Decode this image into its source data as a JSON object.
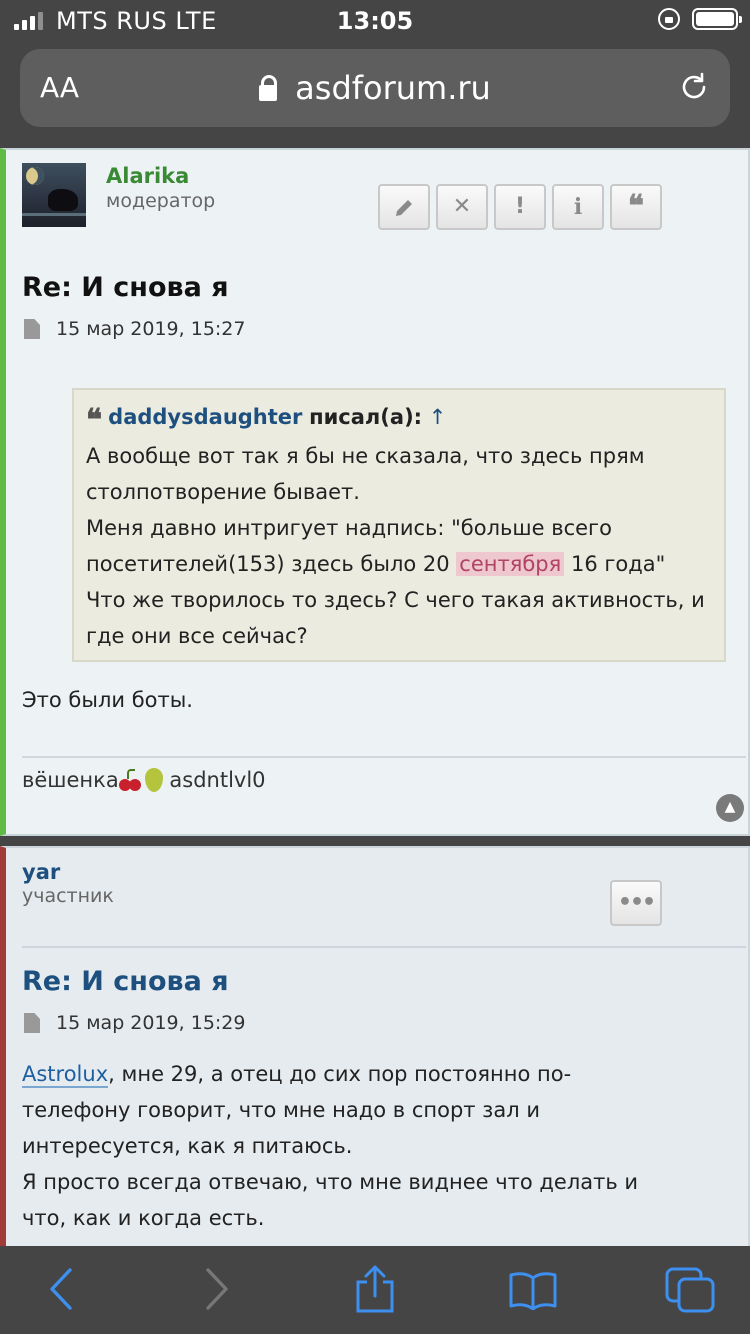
{
  "status_bar": {
    "carrier": "MTS RUS  LTE",
    "time": "13:05"
  },
  "address_bar": {
    "text_size_label": "AA",
    "url": "asdforum.ru"
  },
  "posts": [
    {
      "author": "Alarika",
      "role": "модератор",
      "title": "Re: И снова я",
      "date": "15 мар 2019, 15:27",
      "actions": [
        "edit-icon",
        "delete-icon",
        "report-icon",
        "info-icon",
        "quote-icon"
      ],
      "quote": {
        "author": "daddysdaughter",
        "wrote": "писал(а):",
        "arrow": "↑",
        "line1": "А вообще вот так я бы не сказала, что здесь прям",
        "line2": "столпотворение бывает.",
        "line3": "Меня давно интригует надпись: \"больше всего",
        "line4_a": "посетителей(153) здесь было 20 ",
        "line4_hl": "сентября",
        "line4_b": " 16 года\"",
        "line5": "Что же творилось то здесь? С чего такая активность, и",
        "line6": "где они все сейчас?"
      },
      "reply": "Это были боты.",
      "signature": {
        "part1": "вёшенка",
        "part2": "asdntlvl0"
      }
    },
    {
      "author": "yar",
      "role": "участник",
      "title": "Re: И снова я",
      "date": "15 мар 2019, 15:29",
      "more_label": "•••",
      "mention": "Astrolux",
      "line1_rest": ", мне 29, а отец до сих пор постоянно по-",
      "line2": "телефону говорит, что мне надо в спорт зал и",
      "line3": "интересуется, как я питаюсь.",
      "line4": "Я просто всегда отвечаю, что мне виднее что делать и",
      "line5": "что, как и когда есть."
    }
  ],
  "colors": {
    "moderator": "#3a8a35",
    "link": "#1d4f7f",
    "post1_accent": "#5fbb46",
    "post2_accent": "#a33a3a",
    "ios_blue": "#3d8ff0"
  }
}
